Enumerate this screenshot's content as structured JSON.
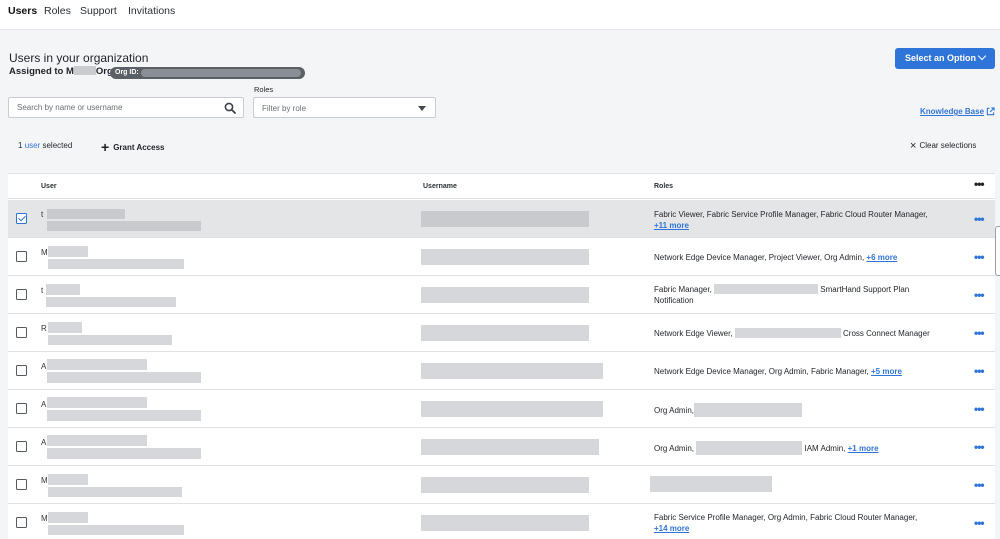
{
  "nav": {
    "tabs": [
      {
        "label": "Users",
        "active": true
      },
      {
        "label": "Roles",
        "active": false
      },
      {
        "label": "Support",
        "active": false
      },
      {
        "label": "Invitations",
        "active": false
      }
    ]
  },
  "header": {
    "title": "Users in your organization",
    "assigned_prefix": "Assigned to M",
    "assigned_suffix": "Org",
    "org_id_label": "Org ID:",
    "select_button": "Select an Option"
  },
  "filters": {
    "search_placeholder": "Search by name or username",
    "roles_label": "Roles",
    "roles_placeholder": "Filter by role",
    "knowledge_base": "Knowledge Base"
  },
  "selection": {
    "count": "1",
    "noun": "user",
    "suffix": "selected",
    "grant_access": "Grant Access",
    "clear": "Clear selections"
  },
  "table": {
    "columns": {
      "user": "User",
      "username": "Username",
      "roles": "Roles"
    },
    "rows": [
      {
        "initial": "t",
        "checked": true,
        "roles_line1": "Fabric Viewer, Fabric Service Profile Manager, Fabric Cloud Router Manager,",
        "roles_line2_more": "+11 more"
      },
      {
        "initial": "M",
        "checked": false,
        "roles_line1": "Network Edge Device Manager, Project Viewer, Org Admin,",
        "roles_more": "+6 more"
      },
      {
        "initial": "t",
        "checked": false,
        "roles_line1_a": "Fabric Manager,",
        "roles_line1_b": "SmartHand Support Plan",
        "roles_line2": "Notification"
      },
      {
        "initial": "R",
        "checked": false,
        "roles_a": "Network Edge Viewer,",
        "roles_b": "Cross Connect Manager"
      },
      {
        "initial": "A",
        "checked": false,
        "roles_line1": "Network Edge Device Manager, Org Admin, Fabric Manager,",
        "roles_more": "+5 more"
      },
      {
        "initial": "A",
        "checked": false,
        "roles_a": "Org Admin,"
      },
      {
        "initial": "A",
        "checked": false,
        "roles_a": "Org Admin,",
        "roles_b": "IAM Admin,",
        "roles_more": "+1 more"
      },
      {
        "initial": "M",
        "checked": false
      },
      {
        "initial": "M",
        "checked": false,
        "roles_line1": "Fabric Service Profile Manager, Org Admin, Fabric Cloud Router Manager,",
        "roles_line2_more": "+14 more"
      }
    ]
  },
  "colors": {
    "accent": "#2f74d8",
    "selected_row": "#e4e5e7",
    "pill": "#5b5f66"
  },
  "icons": {
    "search": "search-icon",
    "external": "external-link-icon",
    "plus": "plus-icon",
    "close": "close-icon",
    "more": "more-horizontal-icon",
    "chevron": "chevron-down-icon"
  }
}
